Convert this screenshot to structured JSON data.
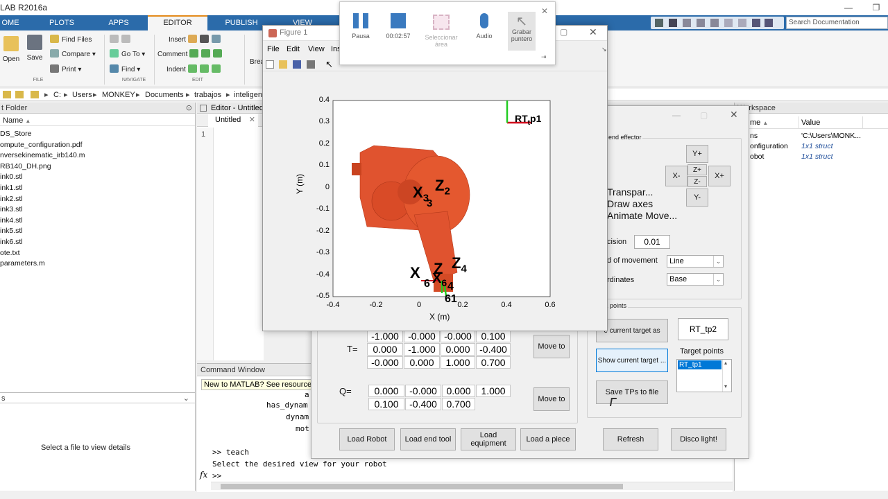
{
  "app": {
    "title": "LAB R2016a"
  },
  "tabs": [
    "OME",
    "PLOTS",
    "APPS",
    "EDITOR",
    "PUBLISH",
    "VIEW"
  ],
  "ribbon": {
    "open": "Open",
    "save": "Save",
    "find_files": "Find Files",
    "compare": "Compare",
    "print": "Print",
    "go_to": "Go To",
    "find": "Find",
    "insert": "Insert",
    "comment": "Comment",
    "indent": "Indent",
    "breakpoints": "Brea",
    "groups": {
      "file": "FILE",
      "navigate": "NAVIGATE",
      "edit": "EDIT"
    }
  },
  "search": {
    "placeholder": "Search Documentation"
  },
  "address": {
    "path": [
      "C:",
      "Users",
      "MONKEY",
      "Documents",
      "trabajos",
      "inteligen"
    ]
  },
  "current_folder": {
    "title": "t Folder",
    "column": "Name",
    "files": [
      "DS_Store",
      "ompute_configuration.pdf",
      "nversekinematic_irb140.m",
      "RB140_DH.png",
      "ink0.stl",
      "ink1.stl",
      "ink2.stl",
      "ink3.stl",
      "ink4.stl",
      "ink5.stl",
      "ink6.stl",
      "ote.txt",
      "parameters.m"
    ],
    "details_title": "s",
    "details_empty": "Select a file to view details"
  },
  "editor": {
    "title": "Editor - Untitled",
    "tab": "Untitled",
    "line1": "1"
  },
  "command_window": {
    "title": "Command Window",
    "banner": "New to MATLAB? See resources f",
    "lines": [
      "a",
      "has_dynam",
      "dynam",
      "mot",
      ">> teach",
      "Select the desired view for your robot",
      ">>"
    ],
    "fx": "fx"
  },
  "workspace": {
    "title": "Workspace",
    "col_name": "me",
    "col_value": "Value",
    "rows": [
      {
        "name": "ns",
        "value": "'C:\\Users\\MONK..."
      },
      {
        "name": "onfiguration",
        "value": "1x1 struct"
      },
      {
        "name": "obot",
        "value": "1x1 struct"
      }
    ]
  },
  "figure": {
    "title": "Figure 1",
    "menu": [
      "File",
      "Edit",
      "View",
      "Ins"
    ],
    "plot": {
      "xlabel": "X (m)",
      "ylabel": "Y (m)",
      "xticks": [
        "-0.4",
        "-0.2",
        "0",
        "0.2",
        "0.4",
        "0.6"
      ],
      "yticks": [
        "0.4",
        "0.3",
        "0.2",
        "0.1",
        "0",
        "-0.1",
        "-0.2",
        "-0.3",
        "-0.4",
        "-0.5"
      ],
      "target_label": "RT",
      "target_sub": "t",
      "target_suffix": "p1",
      "frame_labels": {
        "x3": "X",
        "x3_sub": "3",
        "x3_sub2": "3",
        "z2": "Z",
        "z2_sub": "2",
        "z4": "Z",
        "z4_sub": "4",
        "x_lo": "X",
        "x6": "X",
        "x6_sub": "6",
        "lo_a": "6",
        "lo_b": "4",
        "lo_c": "61"
      }
    }
  },
  "recorder": {
    "pause": "Pausa",
    "time": "00:02:57",
    "select_area": "Seleccionar área",
    "audio": "Audio",
    "pointer": "Grabar puntero"
  },
  "teach": {
    "end_effector": "end effector",
    "jog": {
      "yplus": "Y+",
      "yminus": "Y-",
      "xminus": "X-",
      "xplus": "X+",
      "zplus": "Z+",
      "zminus": "Z-"
    },
    "checks": [
      "Transpar...",
      "Draw axes",
      "Animate Move..."
    ],
    "precision_label": "cision",
    "precision_value": "0.01",
    "movement_label": "d of movement",
    "movement_value": "Line",
    "coords_label": "rdinates",
    "coords_value": "Base",
    "points_title": "points",
    "save_target_as": "e current target as",
    "target_name": "RT_tp2",
    "target_points_label": "Target points",
    "target_points": [
      "RT_tp1"
    ],
    "show_target": "Show current target ...",
    "save_tps": "Save TPs to file",
    "T_label": "T=",
    "T": [
      [
        "-1.000",
        "-0.000",
        "-0.000",
        "0.100"
      ],
      [
        "0.000",
        "-1.000",
        "0.000",
        "-0.400"
      ],
      [
        "-0.000",
        "0.000",
        "1.000",
        "0.700"
      ]
    ],
    "Q_label": "Q=",
    "Q": [
      [
        "0.000",
        "-0.000",
        "0.000",
        "1.000"
      ],
      [
        "0.100",
        "-0.400",
        "0.700"
      ]
    ],
    "move_to": "Move to",
    "load_robot": "Load Robot",
    "load_end_tool": "Load end tool",
    "load_equipment": "Load equipment",
    "load_piece": "Load a piece",
    "refresh": "Refresh",
    "disco": "Disco light!"
  },
  "colors": {
    "accent": "#2b6baa",
    "robot": "#e0532f",
    "target_red": "#d0021b",
    "target_green": "#22cc22",
    "selection": "#0078d7"
  }
}
